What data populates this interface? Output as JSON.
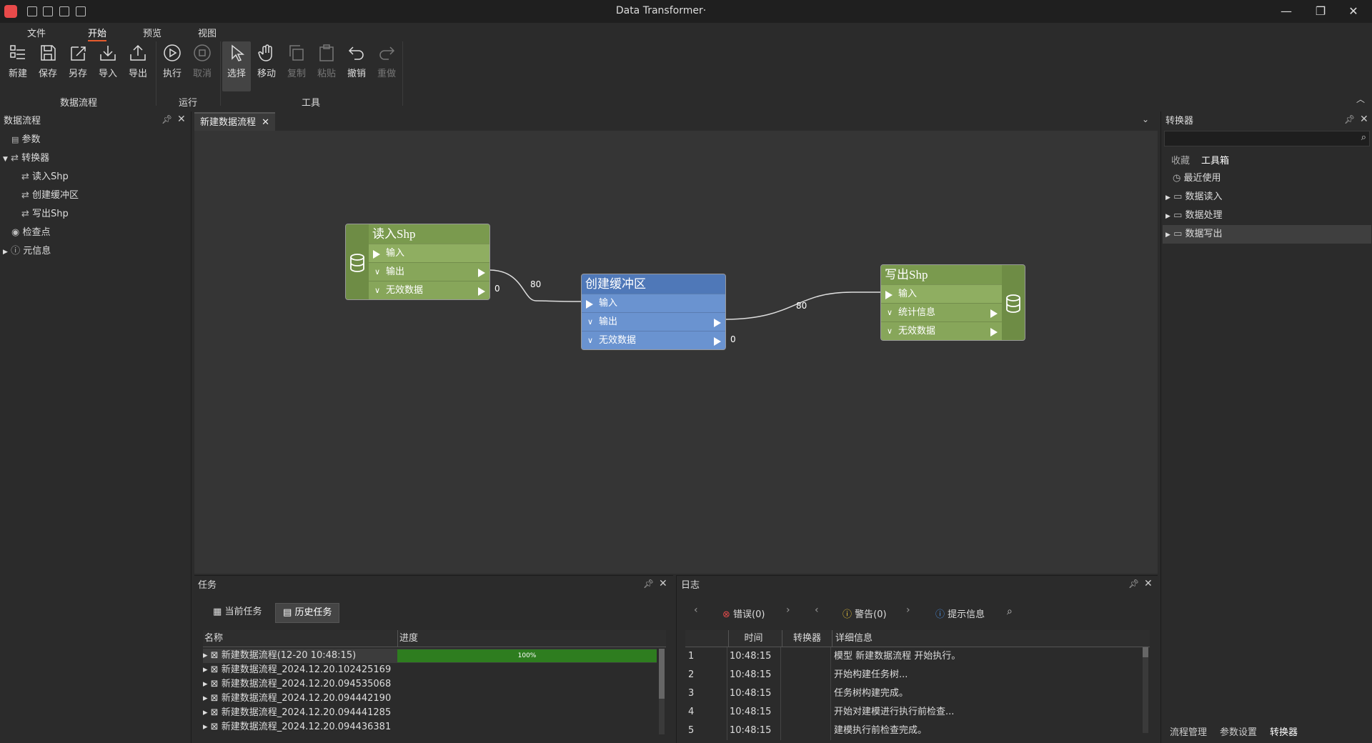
{
  "window": {
    "title": "Data Transformer·"
  },
  "menu": [
    "文件",
    "开始",
    "预览",
    "视图"
  ],
  "ribbon": {
    "buttons": [
      "新建",
      "保存",
      "另存",
      "导入",
      "导出",
      "执行",
      "取消",
      "选择",
      "移动",
      "复制",
      "粘贴",
      "撤销",
      "重做"
    ],
    "groups": [
      "数据流程",
      "运行",
      "工具"
    ]
  },
  "left_panel": {
    "title": "数据流程",
    "items": [
      "参数",
      "转换器",
      "读入Shp",
      "创建缓冲区",
      "写出Shp",
      "检查点",
      "元信息"
    ]
  },
  "doc_tab": {
    "label": "新建数据流程"
  },
  "nodes": {
    "read": {
      "title": "读入Shp",
      "ports": [
        "输入",
        "输出",
        "无效数据"
      ],
      "count_invalid": "0"
    },
    "buffer": {
      "title": "创建缓冲区",
      "ports": [
        "输入",
        "输出",
        "无效数据"
      ],
      "count_invalid": "0"
    },
    "write": {
      "title": "写出Shp",
      "ports": [
        "输入",
        "统计信息",
        "无效数据"
      ]
    },
    "edge_labels": [
      "80",
      "80"
    ]
  },
  "right_panel": {
    "title": "转换器",
    "search_placeholder": "",
    "tabs": [
      "收藏",
      "工具箱"
    ],
    "items": [
      "最近使用",
      "数据读入",
      "数据处理",
      "数据写出"
    ],
    "bottom_tabs": [
      "流程管理",
      "参数设置",
      "转换器"
    ]
  },
  "tasks": {
    "title": "任务",
    "tabs": [
      "当前任务",
      "历史任务"
    ],
    "columns": [
      "名称",
      "进度"
    ],
    "rows": [
      {
        "name": "新建数据流程(12-20 10:48:15)",
        "progress": "100%"
      },
      {
        "name": "新建数据流程_2024.12.20.102425169"
      },
      {
        "name": "新建数据流程_2024.12.20.094535068"
      },
      {
        "name": "新建数据流程_2024.12.20.094442190"
      },
      {
        "name": "新建数据流程_2024.12.20.094441285"
      },
      {
        "name": "新建数据流程_2024.12.20.094436381"
      }
    ]
  },
  "log": {
    "title": "日志",
    "filters": [
      "错误(0)",
      "警告(0)",
      "提示信息"
    ],
    "columns": [
      "时间",
      "转换器",
      "详细信息"
    ],
    "rows": [
      {
        "n": "1",
        "time": "10:48:15",
        "msg": "模型 新建数据流程 开始执行。"
      },
      {
        "n": "2",
        "time": "10:48:15",
        "msg": "开始构建任务树..."
      },
      {
        "n": "3",
        "time": "10:48:15",
        "msg": "任务树构建完成。"
      },
      {
        "n": "4",
        "time": "10:48:15",
        "msg": "开始对建模进行执行前检查..."
      },
      {
        "n": "5",
        "time": "10:48:15",
        "msg": "建模执行前检查完成。"
      }
    ]
  },
  "colors": {
    "accent": "#e65c2e",
    "node_green": "#7a9a4e",
    "node_blue": "#5a84c4",
    "progress": "#2e7d1f"
  }
}
